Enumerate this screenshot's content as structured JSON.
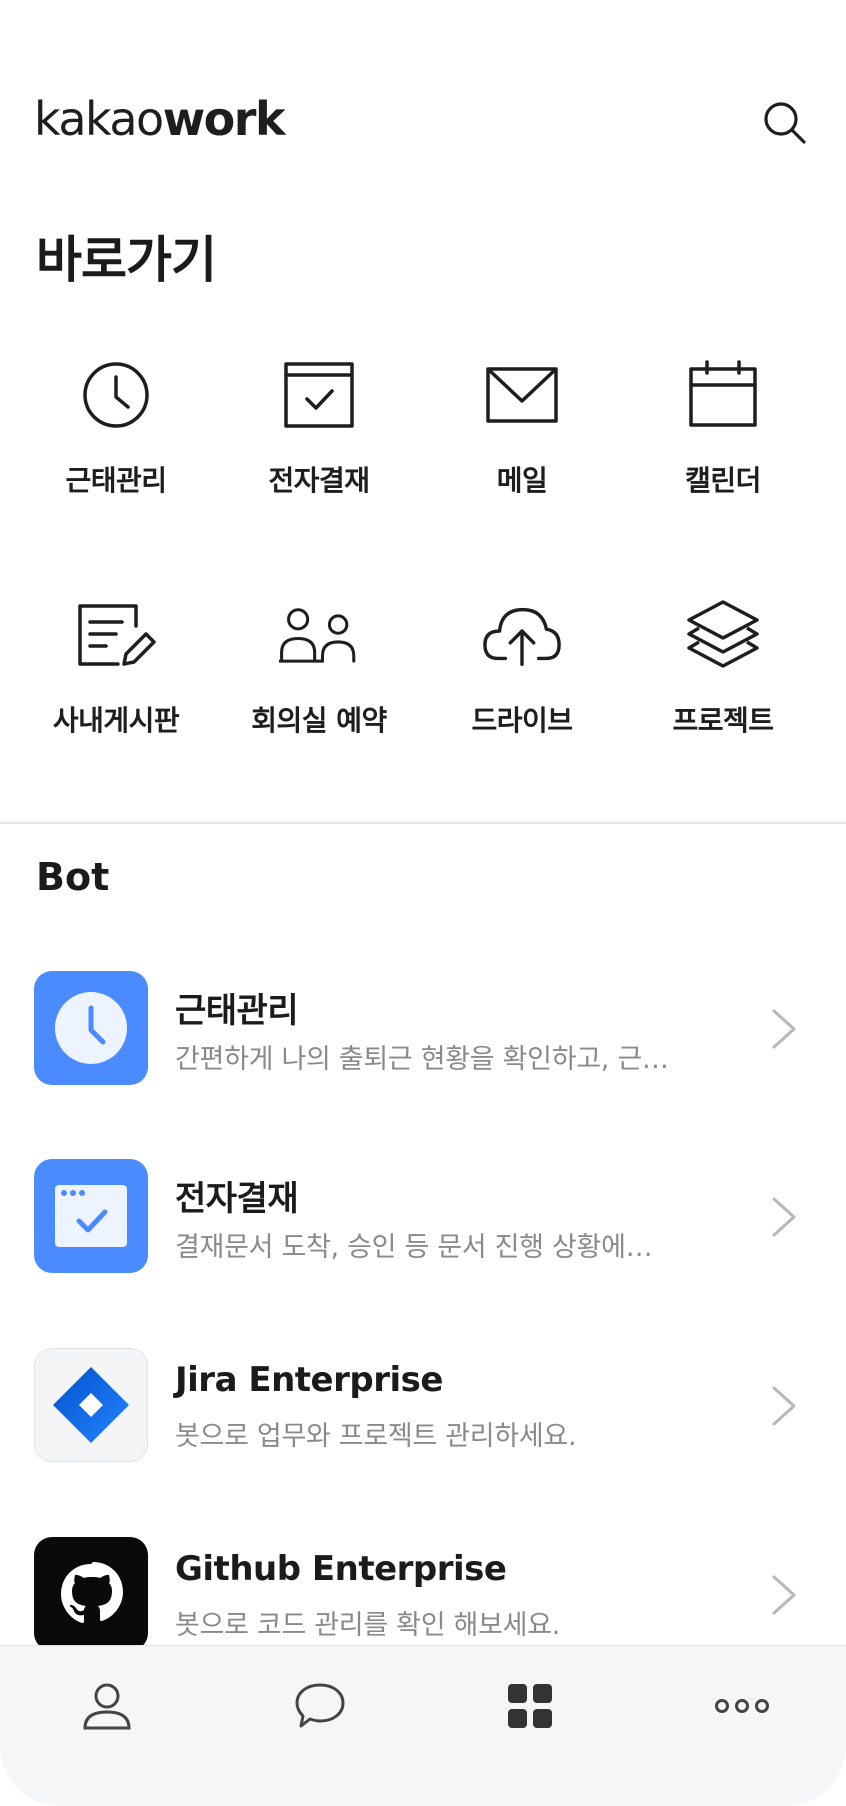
{
  "header": {
    "logo_light": "kakao",
    "logo_bold": "work",
    "search_icon": "search-icon"
  },
  "shortcuts": {
    "title": "바로가기",
    "items": [
      {
        "label": "근태관리",
        "icon": "clock-icon"
      },
      {
        "label": "전자결재",
        "icon": "approval-check-icon"
      },
      {
        "label": "메일",
        "icon": "mail-icon"
      },
      {
        "label": "캘린더",
        "icon": "calendar-icon"
      },
      {
        "label": "사내게시판",
        "icon": "board-edit-icon"
      },
      {
        "label": "회의실 예약",
        "icon": "people-icon"
      },
      {
        "label": "드라이브",
        "icon": "cloud-upload-icon"
      },
      {
        "label": "프로젝트",
        "icon": "layers-icon"
      }
    ]
  },
  "bots": {
    "title": "Bot",
    "items": [
      {
        "name": "근태관리",
        "description": "간편하게 나의 출퇴근 현황을 확인하고, 근…",
        "icon": "clock-bot-icon",
        "color": "#4a8cff"
      },
      {
        "name": "전자결재",
        "description": "결재문서 도착, 승인 등 문서 진행 상황에…",
        "icon": "approval-bot-icon",
        "color": "#4a8cff"
      },
      {
        "name": "Jira Enterprise",
        "description": "봇으로 업무와 프로젝트 관리하세요.",
        "icon": "jira-icon",
        "color": "#2684ff"
      },
      {
        "name": "Github Enterprise",
        "description": "봇으로 코드 관리를 확인 해보세요.",
        "icon": "github-icon",
        "color": "#000000"
      }
    ]
  },
  "tabbar": {
    "items": [
      {
        "icon": "person-icon"
      },
      {
        "icon": "chat-icon"
      },
      {
        "icon": "apps-grid-icon",
        "active": true
      },
      {
        "icon": "more-icon"
      }
    ]
  }
}
